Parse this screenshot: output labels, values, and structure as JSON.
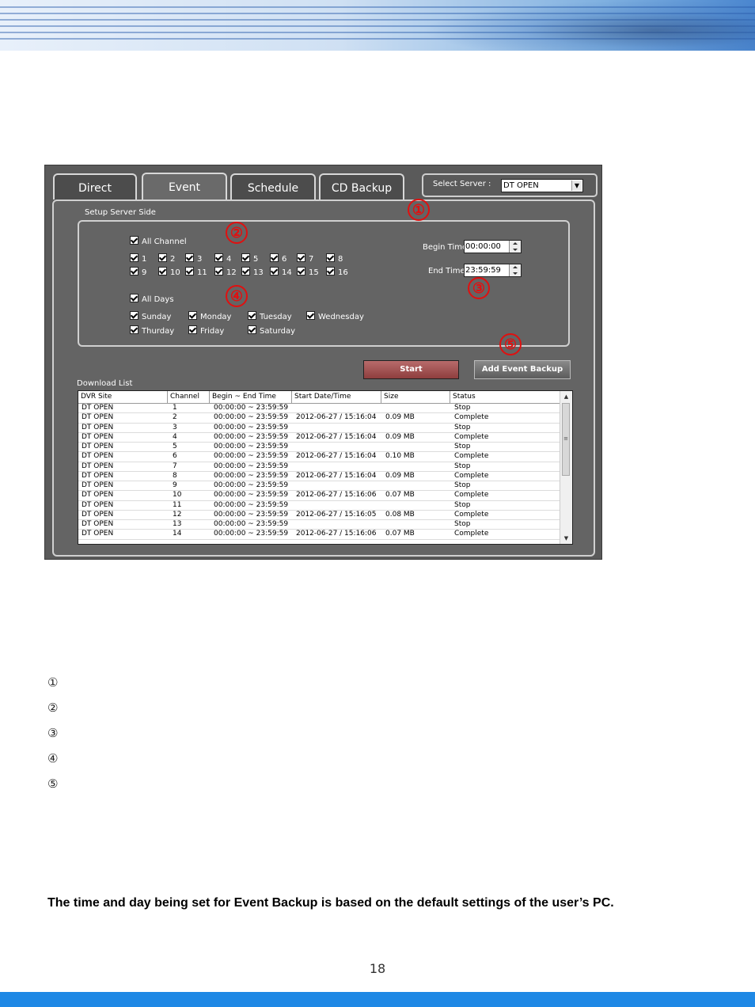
{
  "tabs": [
    {
      "label": "Direct",
      "active": false
    },
    {
      "label": "Event",
      "active": true
    },
    {
      "label": "Schedule",
      "active": false
    },
    {
      "label": "CD Backup",
      "active": false
    }
  ],
  "server": {
    "label": "Select Server :",
    "value": "DT OPEN"
  },
  "setup": {
    "caption": "Setup Server Side",
    "all_channel": "All Channel",
    "channels": [
      "1",
      "2",
      "3",
      "4",
      "5",
      "6",
      "7",
      "8",
      "9",
      "10",
      "11",
      "12",
      "13",
      "14",
      "15",
      "16"
    ],
    "all_days": "All Days",
    "days": [
      "Sunday",
      "Monday",
      "Tuesday",
      "Wednesday",
      "Thurday",
      "Friday",
      "Saturday"
    ],
    "begin_label": "Begin Time",
    "begin_value": "00:00:00",
    "end_label": "End Time",
    "end_value": "23:59:59"
  },
  "buttons": {
    "start": "Start",
    "add": "Add Event Backup"
  },
  "download": {
    "caption": "Download List",
    "columns": [
      "DVR Site",
      "Channel",
      "Begin ~ End Time",
      "Start Date/Time",
      "Size",
      "Status"
    ],
    "rows": [
      [
        "DT OPEN",
        "1",
        "00:00:00 ~ 23:59:59",
        "",
        "",
        "Stop"
      ],
      [
        "DT OPEN",
        "2",
        "00:00:00 ~ 23:59:59",
        "2012-06-27 / 15:16:04",
        "0.09 MB",
        "Complete"
      ],
      [
        "DT OPEN",
        "3",
        "00:00:00 ~ 23:59:59",
        "",
        "",
        "Stop"
      ],
      [
        "DT OPEN",
        "4",
        "00:00:00 ~ 23:59:59",
        "2012-06-27 / 15:16:04",
        "0.09 MB",
        "Complete"
      ],
      [
        "DT OPEN",
        "5",
        "00:00:00 ~ 23:59:59",
        "",
        "",
        "Stop"
      ],
      [
        "DT OPEN",
        "6",
        "00:00:00 ~ 23:59:59",
        "2012-06-27 / 15:16:04",
        "0.10 MB",
        "Complete"
      ],
      [
        "DT OPEN",
        "7",
        "00:00:00 ~ 23:59:59",
        "",
        "",
        "Stop"
      ],
      [
        "DT OPEN",
        "8",
        "00:00:00 ~ 23:59:59",
        "2012-06-27 / 15:16:04",
        "0.09 MB",
        "Complete"
      ],
      [
        "DT OPEN",
        "9",
        "00:00:00 ~ 23:59:59",
        "",
        "",
        "Stop"
      ],
      [
        "DT OPEN",
        "10",
        "00:00:00 ~ 23:59:59",
        "2012-06-27 / 15:16:06",
        "0.07 MB",
        "Complete"
      ],
      [
        "DT OPEN",
        "11",
        "00:00:00 ~ 23:59:59",
        "",
        "",
        "Stop"
      ],
      [
        "DT OPEN",
        "12",
        "00:00:00 ~ 23:59:59",
        "2012-06-27 / 15:16:05",
        "0.08 MB",
        "Complete"
      ],
      [
        "DT OPEN",
        "13",
        "00:00:00 ~ 23:59:59",
        "",
        "",
        "Stop"
      ],
      [
        "DT OPEN",
        "14",
        "00:00:00 ~ 23:59:59",
        "2012-06-27 / 15:16:06",
        "0.07 MB",
        "Complete"
      ]
    ]
  },
  "markers": [
    "①",
    "②",
    "③",
    "④",
    "⑤"
  ],
  "legend": [
    "①",
    "②",
    "③",
    "④",
    "⑤"
  ],
  "note": "The time and day being set for Event Backup is based on the default settings of the user’s PC.",
  "page_number": "18",
  "colors": {
    "marker": "#e01010",
    "bottom_bar": "#1e88e5"
  },
  "icons": {
    "dropdown": "chevron-down-icon",
    "spin": "spinner-arrows-icon",
    "check": "checkmark-icon"
  }
}
